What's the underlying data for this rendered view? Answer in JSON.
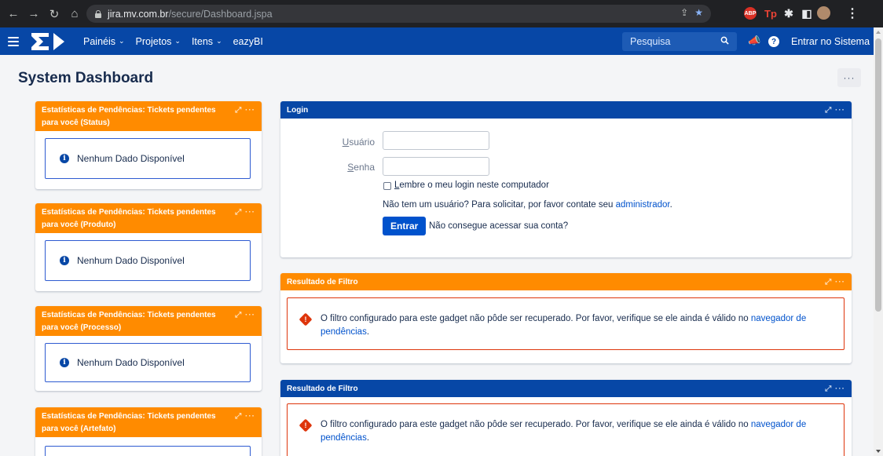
{
  "browser": {
    "url_host": "jira.mv.com.br",
    "url_path": "/secure/Dashboard.jspa",
    "ext_abp": "ABP",
    "ext_tp": "Tp"
  },
  "header": {
    "nav": [
      {
        "label": "Painéis"
      },
      {
        "label": "Projetos"
      },
      {
        "label": "Itens"
      },
      {
        "label": "eazyBI"
      }
    ],
    "search_placeholder": "Pesquisa",
    "login_link": "Entrar no Sistema",
    "help_glyph": "?"
  },
  "page": {
    "title": "System Dashboard",
    "more_label": "···"
  },
  "gadgets_left": [
    {
      "title": "Estatísticas de Pendências: Tickets pendentes para você (Status)",
      "message": "Nenhum Dado Disponível"
    },
    {
      "title": "Estatísticas de Pendências: Tickets pendentes para você (Produto)",
      "message": "Nenhum Dado Disponível"
    },
    {
      "title": "Estatísticas de Pendências: Tickets pendentes para você (Processo)",
      "message": "Nenhum Dado Disponível"
    },
    {
      "title": "Estatísticas de Pendências: Tickets pendentes para você (Artefato)",
      "message": ""
    }
  ],
  "login": {
    "title": "Login",
    "username_label_u": "U",
    "username_label_rest": "suário",
    "password_label_u": "S",
    "password_label_rest": "enha",
    "remember_u": "L",
    "remember_rest": "embre o meu login neste computador",
    "no_account_text": "Não tem um usuário? Para solicitar, por favor contate seu ",
    "no_account_link": "administrador",
    "no_account_end": ".",
    "submit_label": "Entrar",
    "forgot_link": "Não consegue acessar sua conta?"
  },
  "filter_gadgets": [
    {
      "title": "Resultado de Filtro",
      "error_text": "O filtro configurado para este gadget não pôde ser recuperado. Por favor, verifique se ele ainda é válido no ",
      "error_link": "navegador de pendências",
      "error_end": "."
    },
    {
      "title": "Resultado de Filtro",
      "error_text": "O filtro configurado para este gadget não pôde ser recuperado. Por favor, verifique se ele ainda é válido no ",
      "error_link": "navegador de pendências",
      "error_end": "."
    }
  ],
  "gadget_controls": "⤢ ···",
  "colors": {
    "header_blue": "#0747a6",
    "gadget_orange": "#ff8b00",
    "link": "#0052cc",
    "error": "#de350b"
  }
}
